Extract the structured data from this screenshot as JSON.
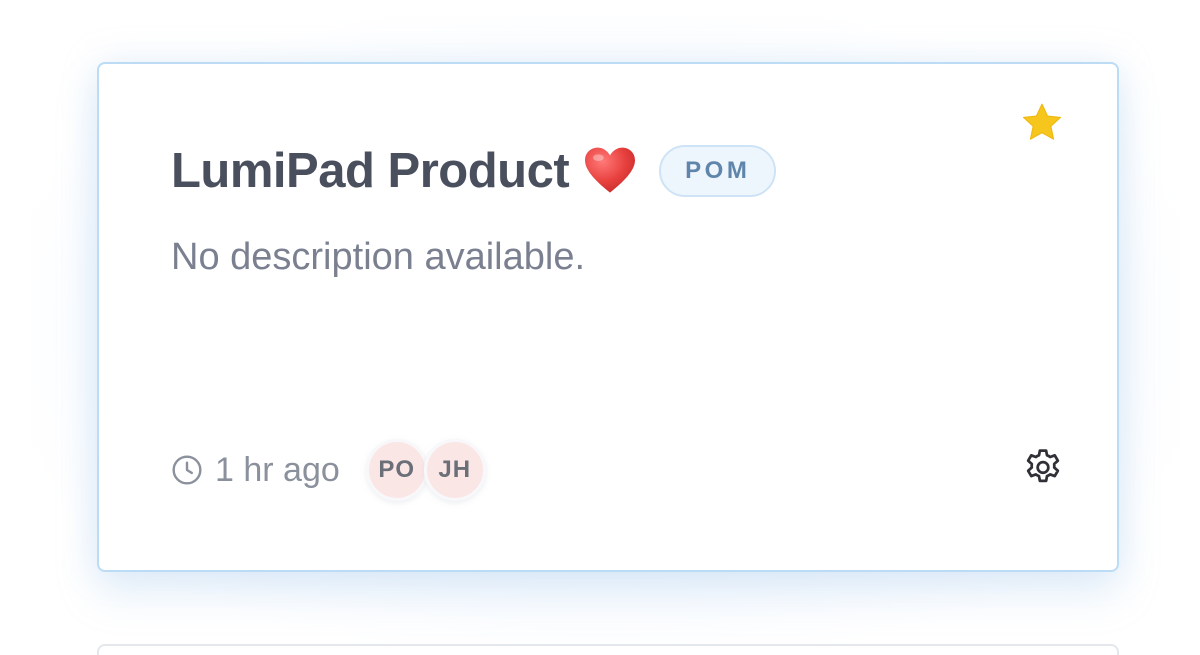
{
  "card": {
    "title": "LumiPad Product",
    "title_emoji": "heart-icon",
    "tag": "POM",
    "description": "No description available.",
    "updated": "1 hr ago",
    "favorited": true,
    "members": [
      {
        "initials": "PO"
      },
      {
        "initials": "JH"
      }
    ]
  },
  "icons": {
    "star": "star-icon",
    "clock": "clock-icon",
    "settings": "gear-icon",
    "heart": "heart-icon"
  },
  "colors": {
    "card_border": "#bcdcf6",
    "title": "#4a4f5e",
    "tag_text": "#5f86aa",
    "tag_bg": "#eef6fd",
    "star": "#f7c61d",
    "heart": "#e8413f",
    "avatar_bg": "#fbe6e6",
    "muted_text": "#7a8090"
  }
}
